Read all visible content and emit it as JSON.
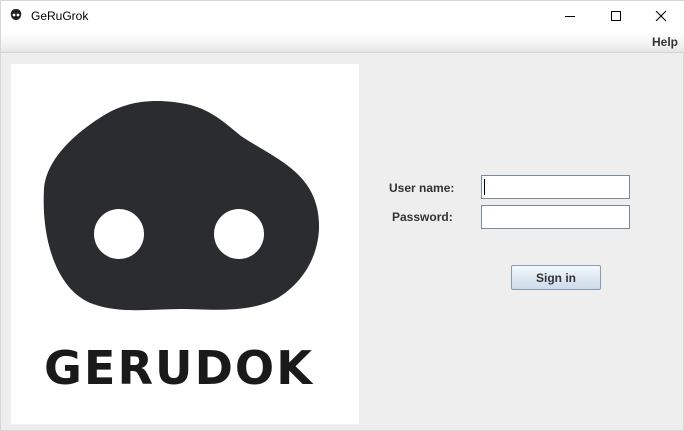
{
  "window": {
    "title": "GeRuGrok",
    "icon": "mask-icon"
  },
  "menu": {
    "help_label": "Help"
  },
  "logo": {
    "text": "GERUDOK",
    "mask_color": "#2b2c2f"
  },
  "login": {
    "username_label": "User name:",
    "username_value": "",
    "password_label": "Password:",
    "password_value": "",
    "signin_label": "Sign in"
  },
  "colors": {
    "window_bg": "#eeeeee",
    "field_border": "#7a8a99",
    "button_border": "#8a9cb0"
  }
}
